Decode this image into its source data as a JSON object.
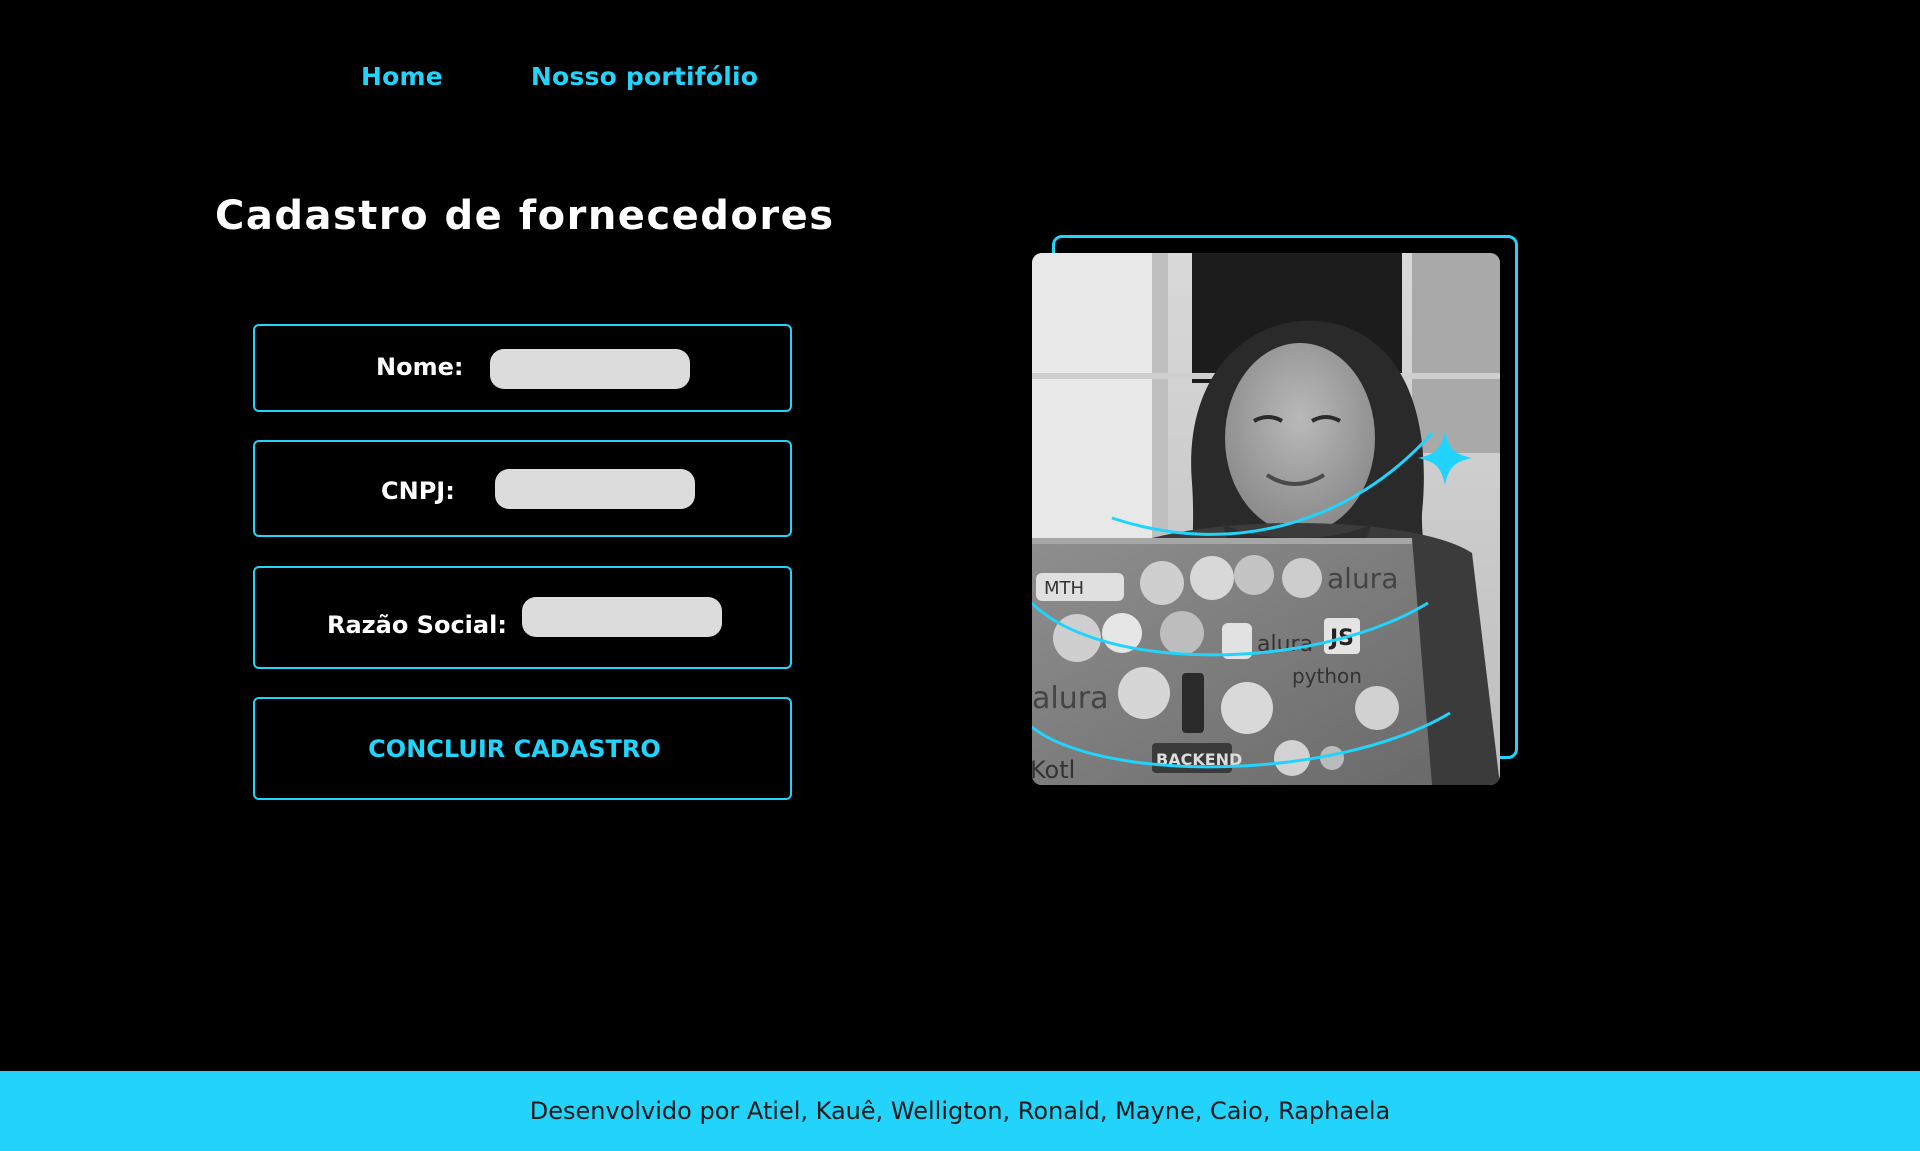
{
  "nav": {
    "items": [
      {
        "label": "Home"
      },
      {
        "label": "Nosso portifólio"
      }
    ]
  },
  "main": {
    "title": "Cadastro de fornecedores"
  },
  "form": {
    "nome": {
      "label": "Nome:",
      "value": ""
    },
    "cnpj": {
      "label": "CNPJ:",
      "value": ""
    },
    "razao": {
      "label": "Razão Social:",
      "value": ""
    },
    "submit_label": "CONCLUIR CADASTRO"
  },
  "illustration": {
    "icons": [
      "sparkle-icon"
    ],
    "photo_subject": "person-with-laptop-photo",
    "sticker_text": [
      "MTH",
      "alura",
      "alura",
      "JS",
      "python",
      "alura",
      "BACKEND",
      "Kotl"
    ]
  },
  "footer": {
    "credits": "Desenvolvido por Atiel, Kauê, Welligton, Ronald, Mayne, Caio, Raphaela"
  },
  "colors": {
    "background": "#000000",
    "accent": "#22d3fb",
    "input_fill": "#dcdcdc",
    "text": "#ffffff"
  }
}
